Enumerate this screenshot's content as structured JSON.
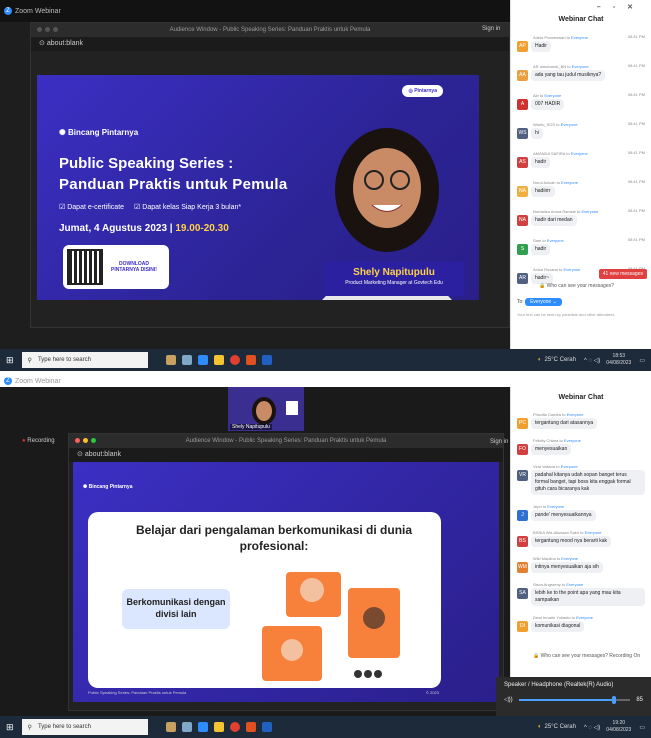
{
  "window": {
    "title": "Zoom Webinar"
  },
  "audience": {
    "title": "Audience Window - Public Speaking Series: Panduan Praktis untuk Pemula",
    "address": "about:blank",
    "signin": "Sign in"
  },
  "slide1": {
    "badge": "Pintarnya",
    "brand": "Bincang Pintarnya",
    "heading1": "Public Speaking Series :",
    "heading2": "Panduan Praktis untuk Pemula",
    "benefit1": "Dapat e-certificate",
    "benefit2": "Dapat kelas Siap Kerja 3 bulan*",
    "date": "Jumat, 4 Agustus 2023 |",
    "time": "19.00-20.30",
    "qr_label": "DOWNLOAD PINTARNYA DISINI!",
    "speaker_name": "Shely Napitupulu",
    "speaker_role": "Product Marketing Manager at Govtech Edu"
  },
  "chat1": {
    "title": "Webinar Chat",
    "messages": [
      {
        "from": "Adela Prameswari",
        "to": "Everyone",
        "time": "08:41 PM",
        "initials": "AP",
        "color": "#f0a030",
        "text": "Hadir"
      },
      {
        "from": "AR almubarok_BN",
        "to": "Everyone",
        "time": "08:41 PM",
        "initials": "AA",
        "color": "#e8a040",
        "text": "ada yang tau judul musiknya?"
      },
      {
        "from": "Ale",
        "to": "Everyone",
        "time": "08:41 PM",
        "initials": "A",
        "color": "#d03030",
        "text": "007 HADIR"
      },
      {
        "from": "Wanto_SOS",
        "to": "Everyone",
        "time": "08:41 PM",
        "initials": "WS",
        "color": "#506080",
        "text": "hi"
      },
      {
        "from": "AMANDA SAFIRA",
        "to": "Everyone",
        "time": "08:41 PM",
        "initials": "AS",
        "color": "#d04040",
        "text": "hadir"
      },
      {
        "from": "Nurul Azizah",
        "to": "Everyone",
        "time": "08:41 PM",
        "initials": "NA",
        "color": "#f0b040",
        "text": "hadiirrr"
      },
      {
        "from": "Nurhaliza Amna Ramsie",
        "to": "Everyone",
        "time": "08:41 PM",
        "initials": "NA",
        "color": "#d04040",
        "text": "hadir dari medan"
      },
      {
        "from": "Sam",
        "to": "Everyone",
        "time": "08:41 PM",
        "initials": "S",
        "color": "#30a050",
        "text": "hadir"
      },
      {
        "from": "Anisa Roxana",
        "to": "Everyone",
        "time": "08:41 PM",
        "initials": "AR",
        "color": "#506080",
        "text": "hadir~"
      }
    ],
    "new_messages": "41 new messages",
    "who": "Who can see your messages?",
    "to_label": "To:",
    "to_value": "Everyone",
    "hint": "Your text can be seen by panelists and other attendees"
  },
  "taskbar1": {
    "search": "Type here to search",
    "weather": "25°C  Cerah",
    "clock": "18:53",
    "date": "04/08/2023"
  },
  "recording": "Recording",
  "speaker_thumb": "Shely Napitupulu",
  "slide2": {
    "brand": "Bincang Pintarnya",
    "heading": "Belajar dari pengalaman berkomunikasi di dunia profesional:",
    "card": "Berkomunikasi dengan divisi lain",
    "footer_left": "Public Speaking Series: Panduan Praktis untuk Pemula",
    "footer_right": "© 2023"
  },
  "chat2": {
    "title": "Webinar Chat",
    "messages": [
      {
        "from": "Priscilla Candra",
        "to": "Everyone",
        "initials": "PC",
        "color": "#f0a030",
        "text": "tergantung dari atasannya"
      },
      {
        "from": "Felicity Chiara",
        "to": "Everyone",
        "initials": "FO",
        "color": "#d04040",
        "text": "menyesuaikan"
      },
      {
        "from": "Vina Valiana",
        "to": "Everyone",
        "initials": "VR",
        "color": "#506080",
        "text": "padahal kitanya udah sopan banget terus formal banget, tapi boss kita enggak formal gituh cara bicaranya kak"
      },
      {
        "from": "Jepri",
        "to": "Everyone",
        "initials": "J",
        "color": "#3070d0",
        "text": "pande' menyesuaikannya"
      },
      {
        "from": "BSNIA Wis Aliunsan Sakri",
        "to": "Everyone",
        "initials": "BS",
        "color": "#d04040",
        "text": "tergantung mood nya berarti kak"
      },
      {
        "from": "Wiki Maulina",
        "to": "Everyone",
        "initials": "WM",
        "color": "#e08030",
        "text": "intinya menyesuaikan aja sih"
      },
      {
        "from": "Sisca Angraeny",
        "to": "Everyone",
        "initials": "SA",
        "color": "#506080",
        "text": "lebih ke to the point apa yang mau kita sampaikan"
      },
      {
        "from": "Dewi Innarie Yulianto",
        "to": "Everyone",
        "initials": "DI",
        "color": "#f0a030",
        "text": "komunikasi diagonal"
      }
    ],
    "who": "Who can see your messages? Recording On"
  },
  "audio_popup": {
    "label": "Speaker / Headphone (Realtek(R) Audio)",
    "level": 0.85
  },
  "taskbar2": {
    "search": "Type here to search",
    "weather": "25°C  Cerah",
    "clock": "19:20",
    "date": "04/08/2023"
  }
}
